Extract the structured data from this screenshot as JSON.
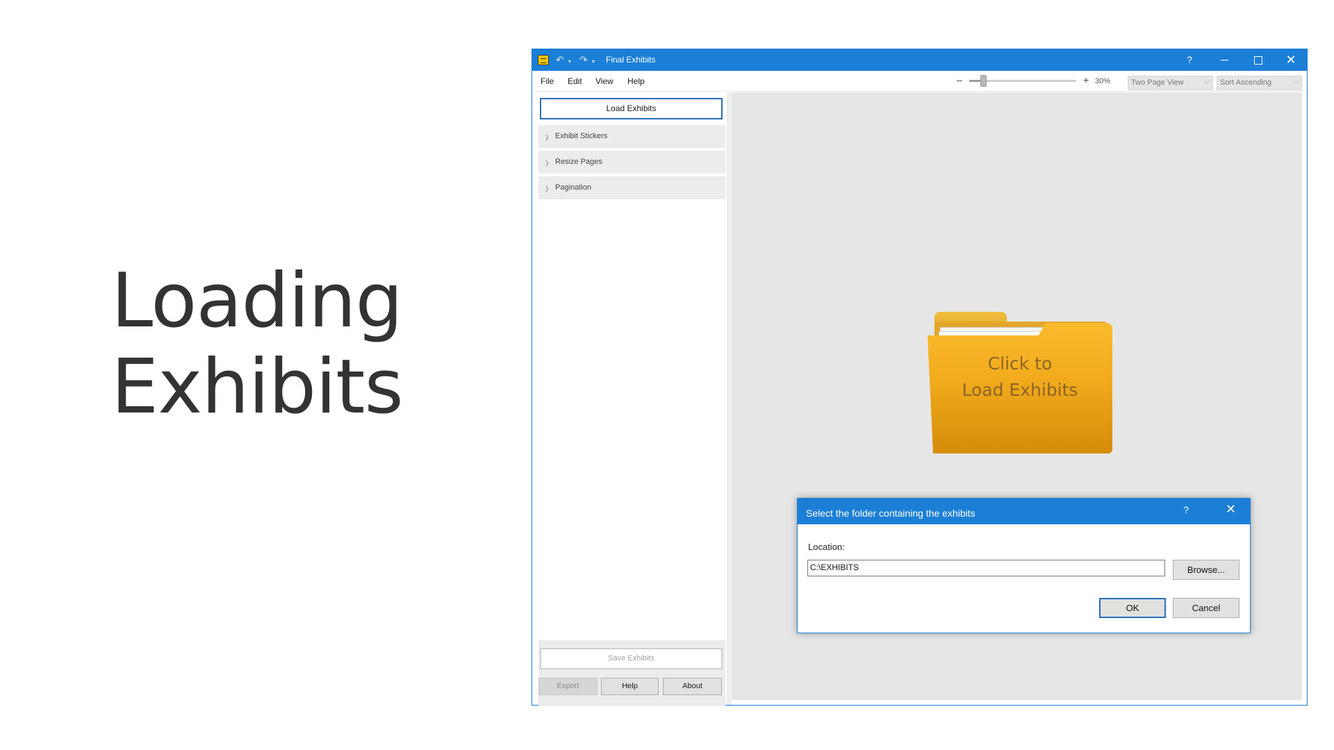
{
  "slide": {
    "title_line1": "Loading",
    "title_line2": "Exhibits"
  },
  "window": {
    "title": "Final Exhibits",
    "help_glyph": "?",
    "close_glyph": "✕"
  },
  "quick_access": {
    "undo_glyph": "↶",
    "redo_glyph": "↷",
    "dropdown_glyph": "▾"
  },
  "menu": {
    "items": [
      "File",
      "Edit",
      "View",
      "Help"
    ]
  },
  "zoom": {
    "minus": "–",
    "plus": "+",
    "level_label": "30%",
    "level": 0.13
  },
  "view_select": {
    "selected": "Two Page View"
  },
  "sort_select": {
    "selected": "Sort Ascending"
  },
  "caret_glyph": "⌵",
  "left_panel": {
    "load_button": "Load Exhibits",
    "chevron_glyph": "〉",
    "sections": [
      "Exhibit Stickers",
      "Resize Pages",
      "Pagination"
    ],
    "save_button": "Save Exhibits",
    "export_button": "Export",
    "help_button": "Help",
    "about_button": "About"
  },
  "content": {
    "folder_label_line1": "Click to",
    "folder_label_line2": "Load Exhibits"
  },
  "dialog": {
    "title": "Select the folder containing the exhibits",
    "help_glyph": "?",
    "close_glyph": "✕",
    "location_label": "Location:",
    "location_value": "C:\\EXHIBITS",
    "browse_button": "Browse...",
    "ok_button": "OK",
    "cancel_button": "Cancel"
  },
  "colors": {
    "accent": "#1b7fd8",
    "folder": "#f1aa1c",
    "content_bg": "#e6e6e6"
  }
}
